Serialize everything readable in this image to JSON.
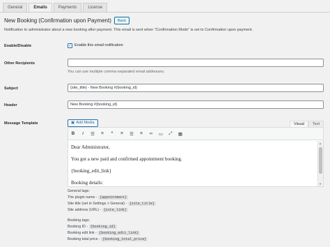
{
  "tabs": [
    "General",
    "Emails",
    "Payments",
    "License"
  ],
  "active_tab": "Emails",
  "heading": "New Booking (Confirmation upon Payment)",
  "back_label": "Back",
  "description": "Notification to administrator about a new booking after payment. This email is sent when \"Confirmation Mode\" is set to Confirmation upon payment.",
  "fields": {
    "enable_label": "Enable/Disable",
    "enable_checkbox_label": "Enable this email notification",
    "enable_checked": true,
    "recipients_label": "Other Recipients",
    "recipients_value": "",
    "recipients_help": "You can use multiple comma-separated email addresses.",
    "subject_label": "Subject",
    "subject_value": "{site_title} - New Booking #{booking_id}",
    "header_label": "Header",
    "header_value": "New Booking #{booking_id}",
    "template_label": "Message Template"
  },
  "editor": {
    "add_media": "Add Media",
    "mode_tabs": [
      "Visual",
      "Text"
    ],
    "active_mode": "Visual",
    "toolbar_icons": [
      "bold-icon",
      "italic-icon",
      "bullet-list-icon",
      "numbered-list-icon",
      "blockquote-icon",
      "align-left-icon",
      "align-center-icon",
      "align-right-icon",
      "link-icon",
      "more-tag-icon",
      "fullscreen-icon",
      "toolbar-toggle-icon"
    ],
    "paragraphs": [
      "Dear Administrator,",
      "You got a new paid and confirmed appointment booking.",
      "{booking_edit_link}",
      "Booking details:"
    ]
  },
  "general_tags": {
    "title": "General tags:",
    "items": [
      {
        "label": "The plugin name - ",
        "tag": "{appointment}"
      },
      {
        "label": "Site title (set in Settings > General) - ",
        "tag": "{site_title}"
      },
      {
        "label": "Site address (URL) - ",
        "tag": "{site_link}"
      }
    ]
  },
  "booking_tags": {
    "title": "Booking tags:",
    "items": [
      {
        "label": "Booking ID - ",
        "tag": "{booking_id}"
      },
      {
        "label": "Booking edit link - ",
        "tag": "{booking_edit_link}"
      },
      {
        "label": "Booking total price - ",
        "tag": "{booking_total_price}"
      }
    ]
  }
}
